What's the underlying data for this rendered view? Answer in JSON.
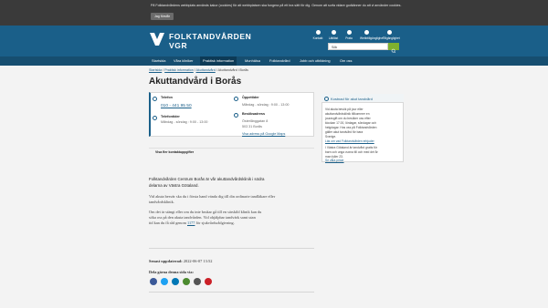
{
  "cookie": {
    "text": "På Folktandvårdens webbplats används kakor (cookies) för att webbplatsen ska fungera på ett bra sätt för dig. Genom att surfa vidare godkänner du att vi använder cookies.",
    "button": "Jag förstår"
  },
  "header": {
    "logo_line1": "FOLKTANDVÅRDEN",
    "logo_line2": "VGR",
    "top_links": [
      "Kontakt",
      "Lättläst",
      "Prata",
      "Webbtillgänglighet",
      "Tillgänglighet"
    ],
    "search_value": "Sök"
  },
  "nav": {
    "items": [
      "Startsida",
      "Våra kliniker",
      "Praktisk information",
      "Munhälsa",
      "Folktandvård",
      "Jobb och utbildning",
      "Om oss"
    ]
  },
  "breadcrumb": {
    "items": [
      "Startsida",
      "Praktisk information",
      "Akuttandvård"
    ],
    "current": "Akuttandvård i Borås",
    "sep": "/"
  },
  "page": {
    "title": "Akuttandvård i Borås"
  },
  "contact": {
    "phone_label": "Telefon",
    "phone": "010 - 441 95 50",
    "phone_hours_label": "Telefontider",
    "phone_hours": "Måndag - söndag : 9:00 - 13:00",
    "open_label": "Öppettider",
    "open_hours": "Måndag - söndag : 9:00 - 13:00",
    "visit_label": "Besöksadress",
    "street": "Österlånggatan 8",
    "city": "503 31 Borås",
    "map_link": "Visa adress på Google Maps",
    "more": "Visa fler kontaktuppgifter"
  },
  "sidebar": {
    "title": "Kostnad för akut tandvård",
    "lines": [
      "Vid akuta besök på jour eller",
      "akuttandvårdsklinik tillkommer en",
      "jouravgift om du besöker oss efter",
      "klockan 17.00, lördagar, söndagar och",
      "helgdagar. Hos oss på Folktandvården",
      "gäller akut tandvård för bara",
      "Sverige."
    ],
    "link1": "Läs om vad Folktandvården erbjuder",
    "lines2": [
      "I Västra Götaland är tandvård gratis för",
      "barn och unga vuxna till och med det år",
      "man fyller 23."
    ],
    "link2": "Se våra priser"
  },
  "content": {
    "intro1": "Folktandvården Centrum Borås är vår akuttandvårdsklinik i södra",
    "intro2": "delarna av Västra Götaland.",
    "p1_l1": "Vid akuta besvär ska du i första hand vända dig till din ordinarie tandläkare eller",
    "p1_l2": "tandvårdsklinik.",
    "p2_l1": "Om det är stängt eller om du inte brukar gå till en särskild klinik kan du",
    "p2_l2": "söka oss på den akuta tandvården. Vid ohjälpbar tandvärk samt utan",
    "p2_l3": "tid kan du få råd genom",
    "p2_link": "1177",
    "p2_l3b": "för sjukvårdsrådgivning."
  },
  "footer": {
    "updated_label": "Senast uppdaterad:",
    "updated": "2022-06-07 13:52",
    "share_label": "Dela gärna denna sida via:",
    "share": [
      "facebook-icon",
      "twitter-icon",
      "linkedin-icon",
      "email-icon",
      "print-icon",
      "pinterest-icon"
    ]
  },
  "colors": {
    "brand_blue": "#1a5f89",
    "nav_blue": "#164e70",
    "search_green": "#7fb02f"
  }
}
